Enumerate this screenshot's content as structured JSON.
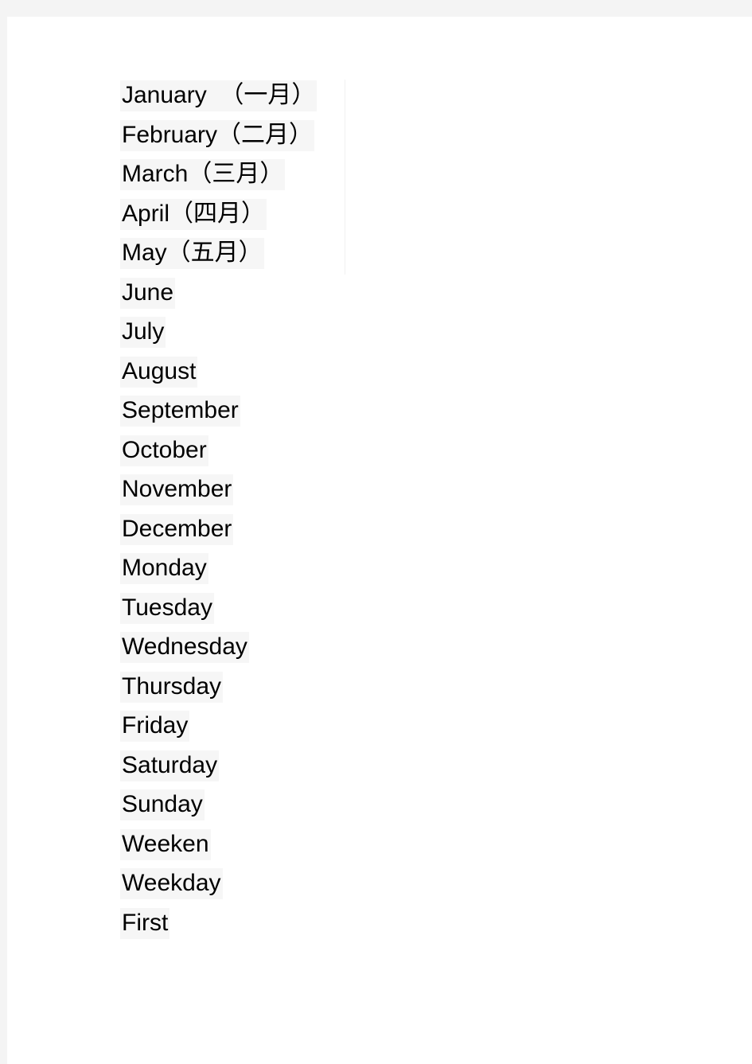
{
  "page": {
    "background_color": "#f4f4f4",
    "paper_color": "#ffffff",
    "text_color": "#000000",
    "highlight_color": "#f6f6f6"
  },
  "word_list": {
    "lines": [
      {
        "text": "January  （一月）"
      },
      {
        "text": "February（二月）"
      },
      {
        "text": "March（三月）"
      },
      {
        "text": "April（四月）"
      },
      {
        "text": "May（五月）"
      },
      {
        "text": "June"
      },
      {
        "text": "July"
      },
      {
        "text": "August"
      },
      {
        "text": "September"
      },
      {
        "text": "October"
      },
      {
        "text": "November"
      },
      {
        "text": "December"
      },
      {
        "text": "Monday"
      },
      {
        "text": "Tuesday"
      },
      {
        "text": "Wednesday"
      },
      {
        "text": "Thursday"
      },
      {
        "text": "Friday"
      },
      {
        "text": "Saturday"
      },
      {
        "text": "Sunday"
      },
      {
        "text": "Weeken"
      },
      {
        "text": "Weekday"
      },
      {
        "text": "First"
      }
    ]
  }
}
